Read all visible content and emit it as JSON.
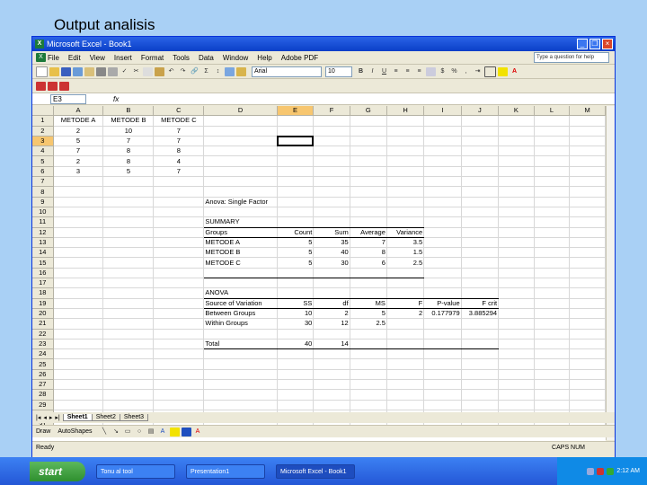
{
  "slide": {
    "title": "Output analisis"
  },
  "window": {
    "title": "Microsoft Excel - Book1"
  },
  "menu": [
    "File",
    "Edit",
    "View",
    "Insert",
    "Format",
    "Tools",
    "Data",
    "Window",
    "Help",
    "Adobe PDF"
  ],
  "help_placeholder": "Type a question for help",
  "format": {
    "font": "Arial",
    "size": "10"
  },
  "namebox": "E3",
  "fx": "fx",
  "columns": [
    "A",
    "B",
    "C",
    "D",
    "E",
    "F",
    "G",
    "H",
    "I",
    "J",
    "K",
    "L",
    "M"
  ],
  "active_col": "E",
  "active_row": 3,
  "rows": [
    [
      "METODE A",
      "METODE B",
      "METODE C",
      "",
      "",
      "",
      "",
      "",
      "",
      "",
      "",
      "",
      ""
    ],
    [
      "2",
      "10",
      "7",
      "",
      "",
      "",
      "",
      "",
      "",
      "",
      "",
      "",
      ""
    ],
    [
      "5",
      "7",
      "7",
      "",
      "",
      "",
      "",
      "",
      "",
      "",
      "",
      "",
      ""
    ],
    [
      "7",
      "8",
      "8",
      "",
      "",
      "",
      "",
      "",
      "",
      "",
      "",
      "",
      ""
    ],
    [
      "2",
      "8",
      "4",
      "",
      "",
      "",
      "",
      "",
      "",
      "",
      "",
      "",
      ""
    ],
    [
      "3",
      "5",
      "7",
      "",
      "",
      "",
      "",
      "",
      "",
      "",
      "",
      "",
      ""
    ],
    [
      "",
      "",
      "",
      "",
      "",
      "",
      "",
      "",
      "",
      "",
      "",
      "",
      ""
    ],
    [
      "",
      "",
      "",
      "",
      "",
      "",
      "",
      "",
      "",
      "",
      "",
      "",
      ""
    ],
    [
      "",
      "",
      "",
      "Anova: Single Factor",
      "",
      "",
      "",
      "",
      "",
      "",
      "",
      "",
      ""
    ],
    [
      "",
      "",
      "",
      "",
      "",
      "",
      "",
      "",
      "",
      "",
      "",
      "",
      ""
    ],
    [
      "",
      "",
      "",
      "SUMMARY",
      "",
      "",
      "",
      "",
      "",
      "",
      "",
      "",
      ""
    ],
    [
      "",
      "",
      "",
      "Groups",
      "Count",
      "Sum",
      "Average",
      "Variance",
      "",
      "",
      "",
      "",
      ""
    ],
    [
      "",
      "",
      "",
      "METODE A",
      "5",
      "35",
      "7",
      "3.5",
      "",
      "",
      "",
      "",
      ""
    ],
    [
      "",
      "",
      "",
      "METODE B",
      "5",
      "40",
      "8",
      "1.5",
      "",
      "",
      "",
      "",
      ""
    ],
    [
      "",
      "",
      "",
      "METODE C",
      "5",
      "30",
      "6",
      "2.5",
      "",
      "",
      "",
      "",
      ""
    ],
    [
      "",
      "",
      "",
      "",
      "",
      "",
      "",
      "",
      "",
      "",
      "",
      "",
      ""
    ],
    [
      "",
      "",
      "",
      "",
      "",
      "",
      "",
      "",
      "",
      "",
      "",
      "",
      ""
    ],
    [
      "",
      "",
      "",
      "ANOVA",
      "",
      "",
      "",
      "",
      "",
      "",
      "",
      "",
      ""
    ],
    [
      "",
      "",
      "",
      "Source of Variation",
      "SS",
      "df",
      "MS",
      "F",
      "P-value",
      "F crit",
      "",
      "",
      ""
    ],
    [
      "",
      "",
      "",
      "Between Groups",
      "10",
      "2",
      "5",
      "2",
      "0.177979",
      "3.885294",
      "",
      "",
      ""
    ],
    [
      "",
      "",
      "",
      "Within Groups",
      "30",
      "12",
      "2.5",
      "",
      "",
      "",
      "",
      "",
      ""
    ],
    [
      "",
      "",
      "",
      "",
      "",
      "",
      "",
      "",
      "",
      "",
      "",
      "",
      ""
    ],
    [
      "",
      "",
      "",
      "Total",
      "40",
      "14",
      "",
      "",
      "",
      "",
      "",
      "",
      ""
    ],
    [
      "",
      "",
      "",
      "",
      "",
      "",
      "",
      "",
      "",
      "",
      "",
      "",
      ""
    ],
    [
      "",
      "",
      "",
      "",
      "",
      "",
      "",
      "",
      "",
      "",
      "",
      "",
      ""
    ],
    [
      "",
      "",
      "",
      "",
      "",
      "",
      "",
      "",
      "",
      "",
      "",
      "",
      ""
    ],
    [
      "",
      "",
      "",
      "",
      "",
      "",
      "",
      "",
      "",
      "",
      "",
      "",
      ""
    ],
    [
      "",
      "",
      "",
      "",
      "",
      "",
      "",
      "",
      "",
      "",
      "",
      "",
      ""
    ],
    [
      "",
      "",
      "",
      "",
      "",
      "",
      "",
      "",
      "",
      "",
      "",
      "",
      ""
    ],
    [
      "",
      "",
      "",
      "",
      "",
      "",
      "",
      "",
      "",
      "",
      "",
      "",
      ""
    ],
    [
      "",
      "",
      "",
      "",
      "",
      "",
      "",
      "",
      "",
      "",
      "",
      "",
      ""
    ]
  ],
  "sheets": [
    "Sheet1",
    "Sheet2",
    "Sheet3"
  ],
  "active_sheet": "Sheet1",
  "drawing": {
    "draw": "Draw",
    "autoshapes": "AutoShapes"
  },
  "status": {
    "left": "Ready",
    "right": "CAPS NUM"
  },
  "taskbar": {
    "start": "start",
    "tasks": [
      "Tonu al tool",
      "Presentation1",
      "Microsoft Excel - Book1"
    ],
    "active": 2,
    "clock": "2:12 AM"
  }
}
